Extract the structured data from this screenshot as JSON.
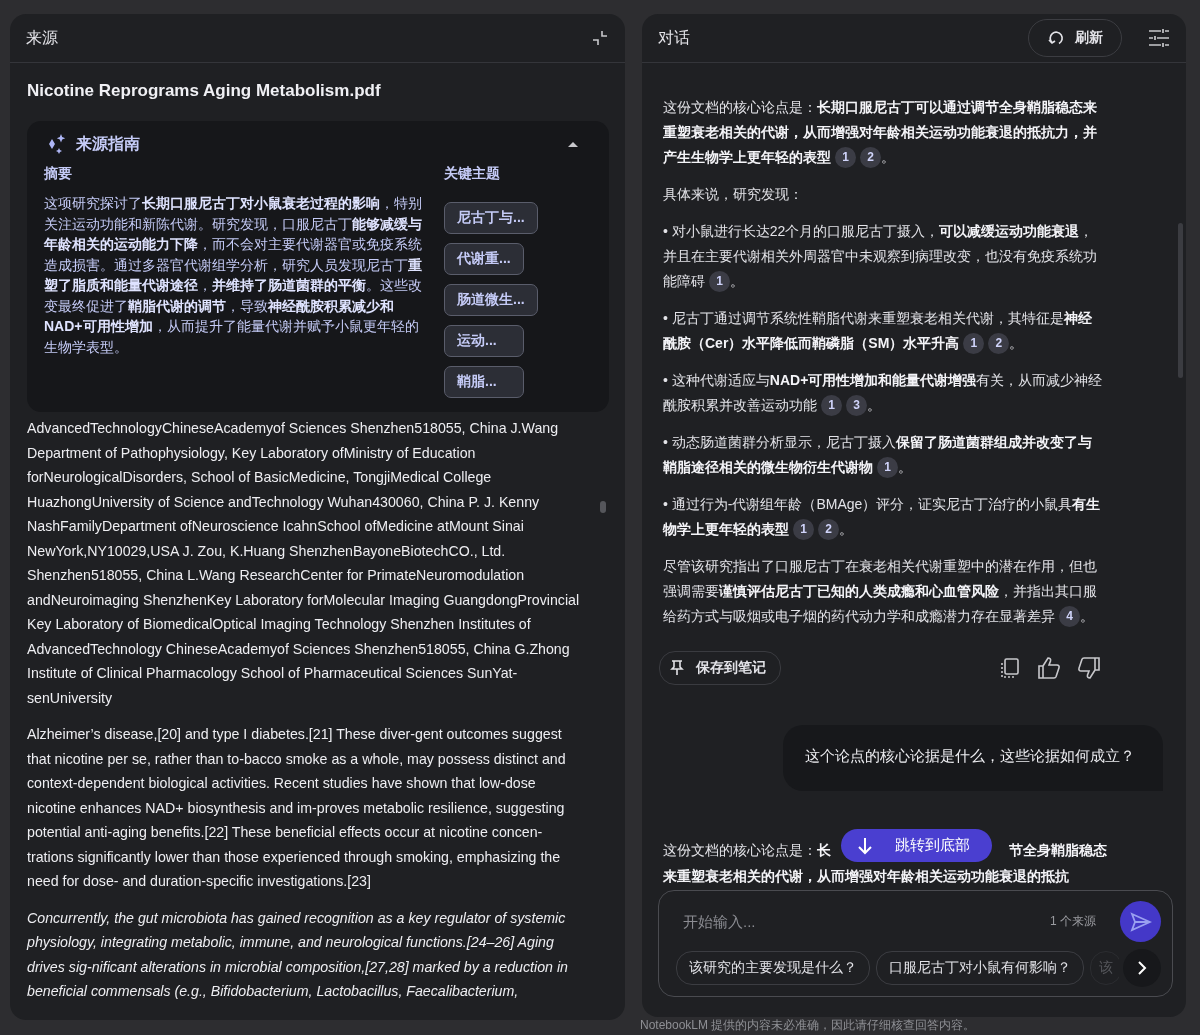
{
  "sources_panel": {
    "title": "来源",
    "document_title": "Nicotine Reprograms Aging Metabolism.pdf",
    "source_guide": {
      "title": "来源指南",
      "expanded": true,
      "summary_heading": "摘要",
      "summary": "这项研究探讨了**长期口服尼古丁对小鼠衰老过程的影响**，特别关注运动功能和新陈代谢。研究发现，口服尼古丁**能够减缓与年龄相关的运动能力下降**，而不会对主要代谢器官或免疫系统造成损害。通过多器官代谢组学分析，研究人员发现尼古丁**重塑了脂质和能量代谢途径**，**并维持了肠道菌群的平衡**。这些改变最终促进了**鞘脂代谢的调节**，导致**神经酰胺积累减少和NAD+可用性增加**，从而提升了能量代谢并赋予小鼠更年轻的生物学表型。",
      "topics_heading": "关键主题",
      "topics": [
        "尼古丁与...",
        "代谢重...",
        "肠道微生...",
        "运动...",
        "鞘脂..."
      ]
    },
    "paragraphs": [
      {
        "kind": "plain",
        "text": "AdvancedTechnologyChineseAcademyof Sciences Shenzhen518055, China J.Wang Department of Pathophysiology, Key Laboratory ofMinistry of Education forNeurologicalDisorders, School of BasicMedicine, TongjiMedical College HuazhongUniversity of Science andTechnology Wuhan430060, China P. J. Kenny NashFamilyDepartment ofNeuroscience IcahnSchool ofMedicine atMount Sinai NewYork,NY10029,USA J. Zou, K.Huang ShenzhenBayoneBiotechCO., Ltd. Shenzhen518055, China L.Wang ResearchCenter for PrimateNeuromodulation andNeuroimaging ShenzhenKey Laboratory forMolecular Imaging GuangdongProvincial Key Laboratory of BiomedicalOptical Imaging Technology Shenzhen Institutes of AdvancedTechnology ChineseAcademyof Sciences Shenzhen518055, China G.Zhong Institute of Clinical Pharmacology School of Pharmaceutical Sciences SunYat-senUniversity"
      },
      {
        "kind": "plain",
        "text": "Alzheimer’s disease,[20] and type I diabetes.[21] These diver-gent outcomes suggest that nicotine per se, rather than to-bacco smoke as a whole, may possess distinct and context-dependent biological activities. Recent studies have shown that low-dose nicotine enhances NAD+ biosynthesis and im-proves metabolic resilience, suggesting potential anti-aging benefits.[22] These beneficial effects occur at nicotine concen-trations significantly lower than those experienced through smoking, emphasizing the need for dose- and duration-specific investigations.[23]"
      },
      {
        "kind": "italic",
        "text": "Concurrently, the gut microbiota has gained recognition as a key regulator of systemic physiology, integrating metabolic, immune, and neurological functions.[24–26] Aging drives sig-nificant alterations in microbial composition,[27,28] marked by a reduction in beneficial commensals (e.g., Bifidobacterium, Lactobacillus, Faecalibacterium,"
      }
    ]
  },
  "chat_panel": {
    "title": "对话",
    "refresh_label": "刷新",
    "answer": [
      {
        "text": "这份文档的核心论点是：**长期口服尼古丁可以通过调节全身鞘脂稳态来重塑衰老相关的代谢，从而增强对年龄相关运动功能衰退的抵抗力，并产生生物学上更年轻的表型**",
        "citations": [
          "1",
          "2"
        ],
        "end": "。"
      },
      {
        "text": "具体来说，研究发现："
      },
      {
        "text": "• 对小鼠进行长达22个月的口服尼古丁摄入，**可以减缓运动功能衰退**，并且在主要代谢相关外周器官中未观察到病理改变，也没有免疫系统功能障碍",
        "citations": [
          "1"
        ],
        "end": "。"
      },
      {
        "text": "• 尼古丁通过调节系统性鞘脂代谢来重塑衰老相关代谢，其特征是**神经酰胺（Cer）水平降低而鞘磷脂（SM）水平升高**",
        "citations": [
          "1",
          "2"
        ],
        "end": "。"
      },
      {
        "text": "• 这种代谢适应与**NAD+可用性增加和能量代谢增强**有关，从而减少神经酰胺积累并改善运动功能",
        "citations": [
          "1",
          "3"
        ],
        "end": "。"
      },
      {
        "text": "• 动态肠道菌群分析显示，尼古丁摄入**保留了肠道菌群组成并改变了与鞘脂途径相关的微生物衍生代谢物**",
        "citations": [
          "1"
        ],
        "end": "。"
      },
      {
        "text": "• 通过行为-代谢组年龄（BMAge）评分，证实尼古丁治疗的小鼠具**有生物学上更年轻的表型**",
        "citations": [
          "1",
          "2"
        ],
        "end": "。"
      },
      {
        "text": "尽管该研究指出了口服尼古丁在衰老相关代谢重塑中的潜在作用，但也强调需要**谨慎评估尼古丁已知的人类成瘾和心血管风险**，并指出其口服给药方式与吸烟或电子烟的药代动力学和成瘾潜力存在显著差异",
        "citations": [
          "4"
        ],
        "end": "。"
      }
    ],
    "save_label": "保存到笔记",
    "question": "这个论点的核心论据是什么，这些论据如何成立？",
    "next_answer_start": "这份文档的核心论点是：",
    "next_answer_bold_start": "长",
    "next_answer_bold_end": "节全身鞘脂稳态",
    "next_answer_line2": "来重塑衰老相关的代谢，从而增强对年龄相关运动功能衰退的抵抗",
    "jump_label": "跳转到底部",
    "input": {
      "placeholder": "开始输入...",
      "source_count": "1 个来源"
    },
    "suggestions": [
      "该研究的主要发现是什么？",
      "口服尼古丁对小鼠有何影响？",
      "该"
    ]
  },
  "footer": "NotebookLM 提供的内容未必准确，因此请仔细核查回答内容。"
}
